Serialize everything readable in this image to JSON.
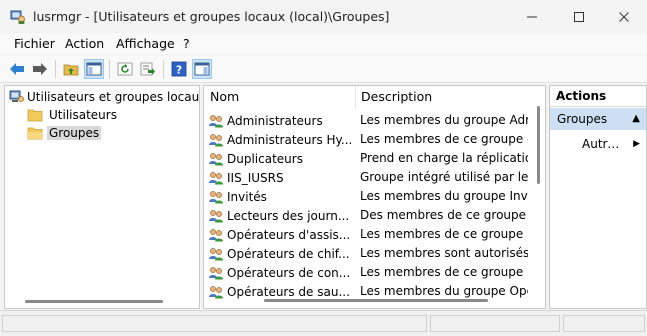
{
  "window": {
    "title": "lusrmgr - [Utilisateurs et groupes locaux (local)\\Groupes]",
    "minimize_glyph": "—",
    "maximize_glyph": "☐",
    "close_glyph": "✕"
  },
  "menu": {
    "items": [
      "Fichier",
      "Action",
      "Affichage",
      "?"
    ]
  },
  "toolbar": {
    "icons": [
      "back-arrow-icon",
      "forward-arrow-icon",
      "up-folder-icon",
      "console-tree-icon",
      "refresh-icon",
      "export-list-icon",
      "help-icon",
      "action-pane-icon"
    ]
  },
  "tree": {
    "root_label": "Utilisateurs et groupes locaux (local)",
    "children": [
      "Utilisateurs",
      "Groupes"
    ],
    "selected": "Groupes"
  },
  "list": {
    "columns": [
      "Nom",
      "Description"
    ],
    "rows": [
      {
        "name": "Administrateurs",
        "description": "Les membres du groupe Administrateurs"
      },
      {
        "name": "Administrateurs Hyper-V",
        "description": "Les membres de ce groupe disposent"
      },
      {
        "name": "Duplicateurs",
        "description": "Prend en charge la réplication de"
      },
      {
        "name": "IIS_IUSRS",
        "description": "Groupe intégré utilisé par les services"
      },
      {
        "name": "Invités",
        "description": "Les membres du groupe Invités ont"
      },
      {
        "name": "Lecteurs des journaux d'événements",
        "description": "Des membres de ce groupe peuvent"
      },
      {
        "name": "Opérateurs d'assistance",
        "description": "Les membres de ce groupe peuvent"
      },
      {
        "name": "Opérateurs de chiffrement",
        "description": "Les membres sont autorisés à effectuer"
      },
      {
        "name": "Opérateurs de configuration réseau",
        "description": "Les membres de ce groupe peuvent"
      },
      {
        "name": "Opérateurs de sauvegarde",
        "description": "Les membres du groupe Opérateurs"
      }
    ]
  },
  "actions": {
    "title": "Actions",
    "group_label": "Groupes",
    "group_glyph": "▲",
    "more_label": "Autres actions",
    "more_glyph": "▶"
  },
  "colors": {
    "selection": "#cde0f3",
    "accent": "#1e6fd1"
  }
}
